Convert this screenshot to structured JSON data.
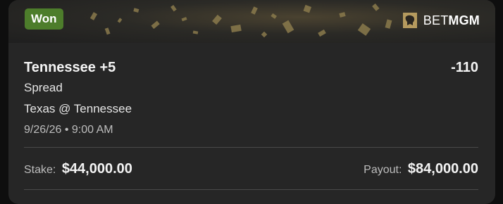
{
  "banner": {
    "status": "Won",
    "brand_prefix": "BET",
    "brand_suffix": "MGM",
    "brand_icon": "lion-logo-icon",
    "status_color": "#4d7d2b"
  },
  "selection": {
    "title": "Tennessee +5",
    "odds": "-110",
    "market": "Spread",
    "event": "Texas @ Tennessee",
    "datetime": "9/26/26 • 9:00 AM"
  },
  "footer": {
    "stake_label": "Stake:",
    "stake_value": "$44,000.00",
    "payout_label": "Payout:",
    "payout_value": "$84,000.00"
  }
}
